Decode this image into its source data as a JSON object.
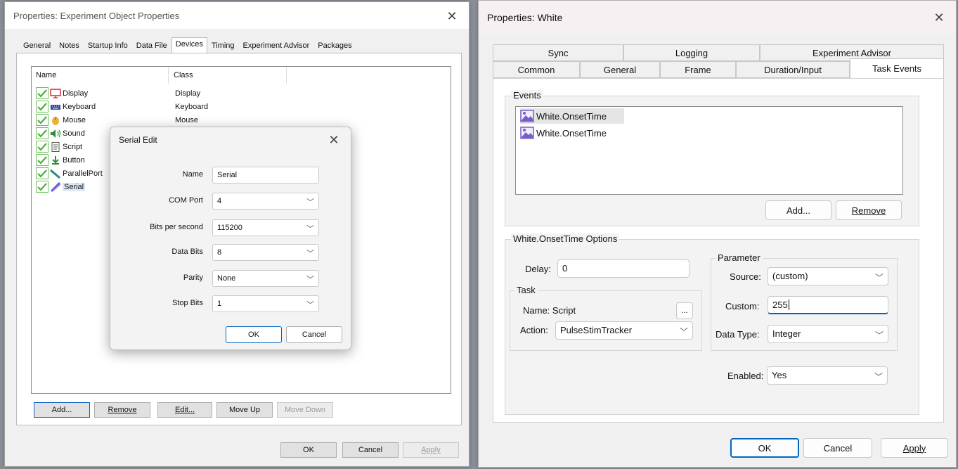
{
  "left_window": {
    "title": "Properties: Experiment Object Properties",
    "tabs": [
      "General",
      "Notes",
      "Startup Info",
      "Data File",
      "Devices",
      "Timing",
      "Experiment Advisor",
      "Packages"
    ],
    "active_tab": "Devices",
    "columns": {
      "name": "Name",
      "class": "Class"
    },
    "devices": [
      {
        "name": "Display",
        "class": "Display",
        "icon": "display-icon"
      },
      {
        "name": "Keyboard",
        "class": "Keyboard",
        "icon": "keyboard-icon"
      },
      {
        "name": "Mouse",
        "class": "Mouse",
        "icon": "mouse-icon"
      },
      {
        "name": "Sound",
        "class": "",
        "icon": "sound-icon"
      },
      {
        "name": "Script",
        "class": "",
        "icon": "script-icon"
      },
      {
        "name": "Button",
        "class": "",
        "icon": "button-icon"
      },
      {
        "name": "ParallelPort",
        "class": "",
        "icon": "parallel-port-icon"
      },
      {
        "name": "Serial",
        "class": "",
        "icon": "serial-icon"
      }
    ],
    "buttons": {
      "add": "Add...",
      "remove": "Remove",
      "edit": "Edit...",
      "move_up": "Move Up",
      "move_down": "Move Down",
      "ok": "OK",
      "cancel": "Cancel",
      "apply": "Apply"
    }
  },
  "serial_dialog": {
    "title": "Serial Edit",
    "fields": {
      "name": {
        "label": "Name",
        "value": "Serial"
      },
      "com_port": {
        "label": "COM Port",
        "value": "4"
      },
      "bits_per_second": {
        "label": "Bits per second",
        "value": "115200"
      },
      "data_bits": {
        "label": "Data Bits",
        "value": "8"
      },
      "parity": {
        "label": "Parity",
        "value": "None"
      },
      "stop_bits": {
        "label": "Stop Bits",
        "value": "1"
      }
    },
    "ok": "OK",
    "cancel": "Cancel"
  },
  "right_window": {
    "title": "Properties: White",
    "tabs_back": [
      "Sync",
      "Logging",
      "Experiment Advisor"
    ],
    "tabs_front": [
      "Common",
      "General",
      "Frame",
      "Duration/Input",
      "Task Events"
    ],
    "active_tab": "Task Events",
    "events_group": "Events",
    "events": [
      "White.OnsetTime",
      "White.OnsetTime"
    ],
    "add": "Add...",
    "remove": "Remove",
    "options_group": "White.OnsetTime Options",
    "delay_label": "Delay:",
    "delay_value": "0",
    "task_group": "Task",
    "task_name_label": "Name: Script",
    "ellipsis": "...",
    "action_label": "Action:",
    "action_value": "PulseStimTracker",
    "parameter_group": "Parameter",
    "source_label": "Source:",
    "source_value": "(custom)",
    "custom_label": "Custom:",
    "custom_value": "255",
    "data_type_label": "Data Type:",
    "data_type_value": "Integer",
    "enabled_label": "Enabled:",
    "enabled_value": "Yes",
    "ok": "OK",
    "cancel": "Cancel",
    "apply": "Apply"
  }
}
